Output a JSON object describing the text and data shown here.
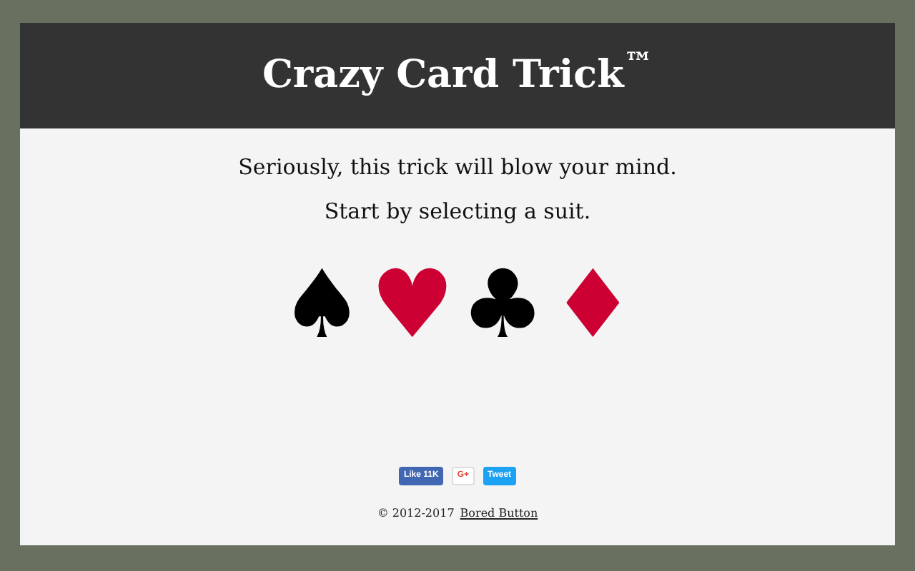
{
  "header": {
    "title": "Crazy Card Trick$^{™}$"
  },
  "intro": [
    "Seriously, this trick will blow your mind.",
    "Start by selecting a suit."
  ],
  "suits": [
    {
      "symbol": "♠",
      "color": "#000000"
    },
    {
      "symbol": "♥",
      "color": "#cc0033"
    },
    {
      "symbol": "♣",
      "color": "#000000"
    },
    {
      "symbol": "♦",
      "color": "#cc0033"
    }
  ],
  "social": [
    {
      "kind": "like",
      "label": "Like 11K"
    },
    {
      "kind": "gplus",
      "label": "G+"
    },
    {
      "kind": "tweet",
      "label": "Tweet"
    }
  ],
  "footer": {
    "copyright": "© 2012-2017",
    "link": "Bored Button"
  }
}
